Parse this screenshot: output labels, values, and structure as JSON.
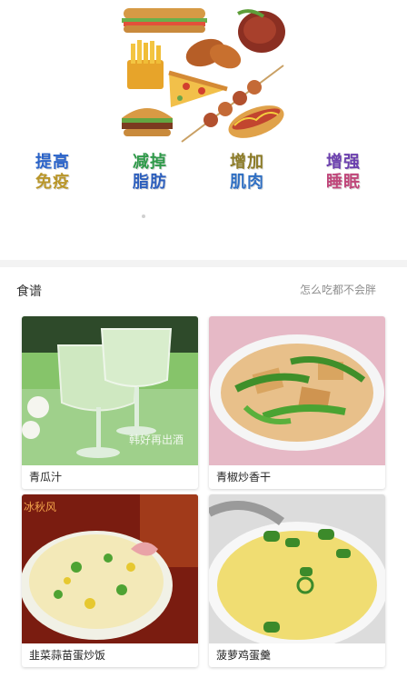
{
  "categories": [
    {
      "line1": "提高",
      "line2": "免疫",
      "color1": "#2a63c9",
      "color2": "#b9962a"
    },
    {
      "line1": "减掉",
      "line2": "脂肪",
      "color1": "#2f9a4a",
      "color2": "#2d5fbd"
    },
    {
      "line1": "增加",
      "line2": "肌肉",
      "color1": "#8c7b27",
      "color2": "#2f6fc3"
    },
    {
      "line1": "增强",
      "line2": "睡眠",
      "color1": "#6b3fae",
      "color2": "#c0467a"
    }
  ],
  "section": {
    "title": "食谱",
    "subtitle": "怎么吃都不会胖"
  },
  "recipes": [
    {
      "name": "青瓜汁",
      "watermark": "韩好再出酒"
    },
    {
      "name": "青椒炒香干"
    },
    {
      "name": "韭菜蒜苗蛋炒饭",
      "watermark": "冰秋风"
    },
    {
      "name": "菠萝鸡蛋羹"
    }
  ]
}
